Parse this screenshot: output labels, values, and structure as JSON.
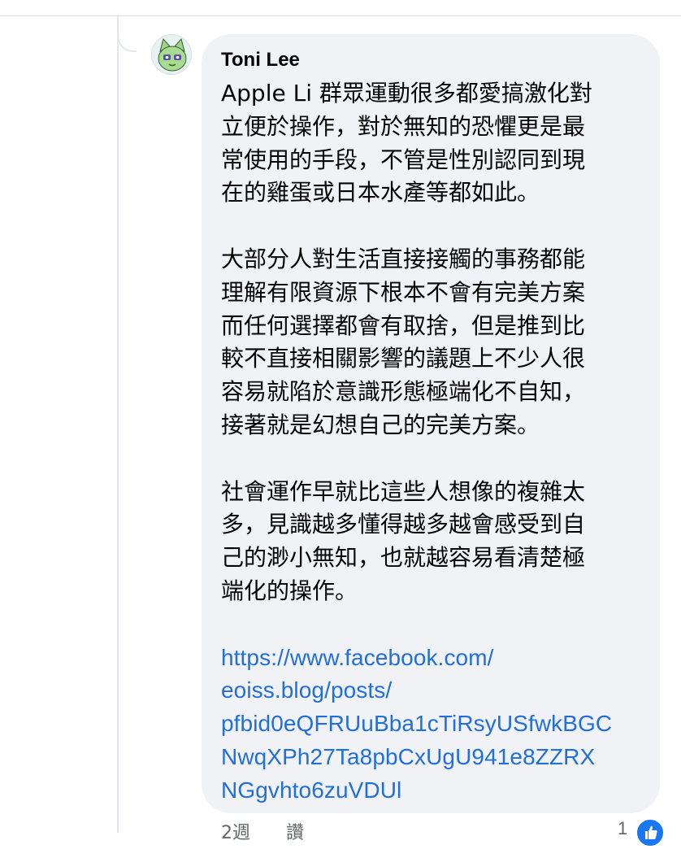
{
  "comment": {
    "author": "Toni Lee",
    "paragraphs": [
      "Apple Li 群眾運動很多都愛搞激化對\n立便於操作，對於無知的恐懼更是最\n常使用的手段，不管是性別認同到現\n在的雞蛋或日本水產等都如此。",
      "大部分人對生活直接接觸的事務都能\n理解有限資源下根本不會有完美方案\n而任何選擇都會有取捨，但是推到比\n較不直接相關影響的議題上不少人很\n容易就陷於意識形態極端化不自知，\n接著就是幻想自己的完美方案。",
      "社會運作早就比這些人想像的複雜太\n多，見識越多懂得越多越會感受到自\n己的渺小無知，也就越容易看清楚極\n端化的操作。"
    ],
    "link": "https://www.facebook.com/\neoiss.blog/posts/\npfbid0eQFRUuBba1cTiRsyUSfwkBGC\nNwqXPh27Ta8pbCxUgU941e8ZZRX\nNGgvhto6zuVDUl",
    "timestamp": "2週",
    "like_action": "讚",
    "reaction_count": "1",
    "avatar_icon": "cat-avatar-icon",
    "reaction_icon": "thumbs-up-icon"
  },
  "colors": {
    "bubble_bg": "#f0f2f5",
    "link": "#216fdb",
    "text": "#050505",
    "meta": "#65676b",
    "like_blue": "#1877f2"
  }
}
